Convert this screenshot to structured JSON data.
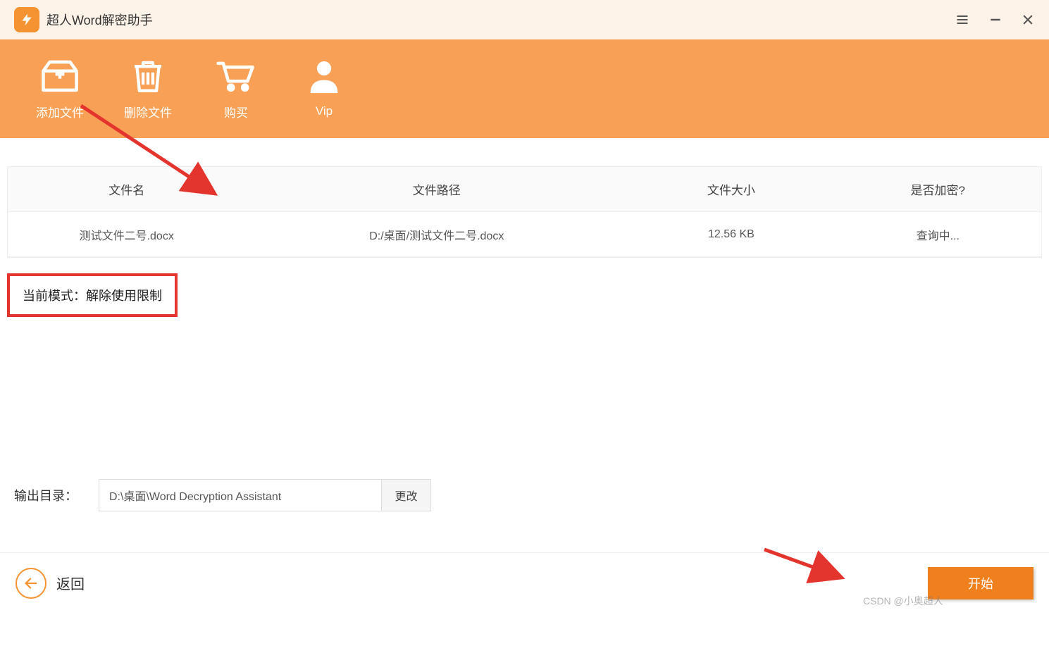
{
  "app": {
    "title": "超人Word解密助手"
  },
  "toolbar": {
    "add_label": "添加文件",
    "delete_label": "删除文件",
    "buy_label": "购买",
    "vip_label": "Vip"
  },
  "table": {
    "headers": {
      "name": "文件名",
      "path": "文件路径",
      "size": "文件大小",
      "encrypted": "是否加密?"
    },
    "rows": [
      {
        "name": "测试文件二号.docx",
        "path": "D:/桌面/测试文件二号.docx",
        "size": "12.56 KB",
        "encrypted": "查询中..."
      }
    ]
  },
  "mode_status": "当前模式：解除使用限制",
  "output": {
    "label": "输出目录：",
    "path": "D:\\桌面\\Word Decryption Assistant",
    "change_label": "更改"
  },
  "footer": {
    "back_label": "返回",
    "start_label": "开始"
  },
  "watermark": "CSDN @小奥超人"
}
